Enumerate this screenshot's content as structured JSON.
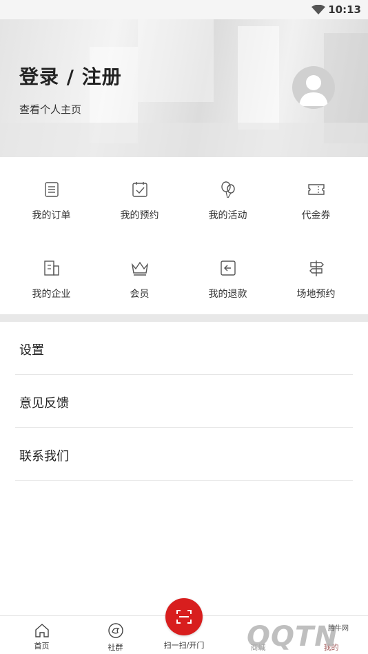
{
  "status_bar": {
    "time": "10:13"
  },
  "header": {
    "title": "登录 / 注册",
    "subtitle": "查看个人主页"
  },
  "grid": [
    {
      "label": "我的订单",
      "icon": "order-icon"
    },
    {
      "label": "我的预约",
      "icon": "appointment-icon"
    },
    {
      "label": "我的活动",
      "icon": "balloon-icon"
    },
    {
      "label": "代金券",
      "icon": "voucher-icon"
    },
    {
      "label": "我的企业",
      "icon": "building-icon"
    },
    {
      "label": "会员",
      "icon": "crown-icon"
    },
    {
      "label": "我的退款",
      "icon": "refund-icon"
    },
    {
      "label": "场地预约",
      "icon": "signpost-icon"
    }
  ],
  "list": [
    {
      "label": "设置"
    },
    {
      "label": "意见反馈"
    },
    {
      "label": "联系我们"
    }
  ],
  "tabbar": {
    "home": "首页",
    "community": "社群",
    "scan": "扫一扫/开门",
    "mall": "商城",
    "mine": "我的"
  },
  "watermark": {
    "text": "QQTN",
    "small": "腾牛网"
  },
  "colors": {
    "accent": "#d81e1e",
    "divider": "#e8e8e8"
  }
}
